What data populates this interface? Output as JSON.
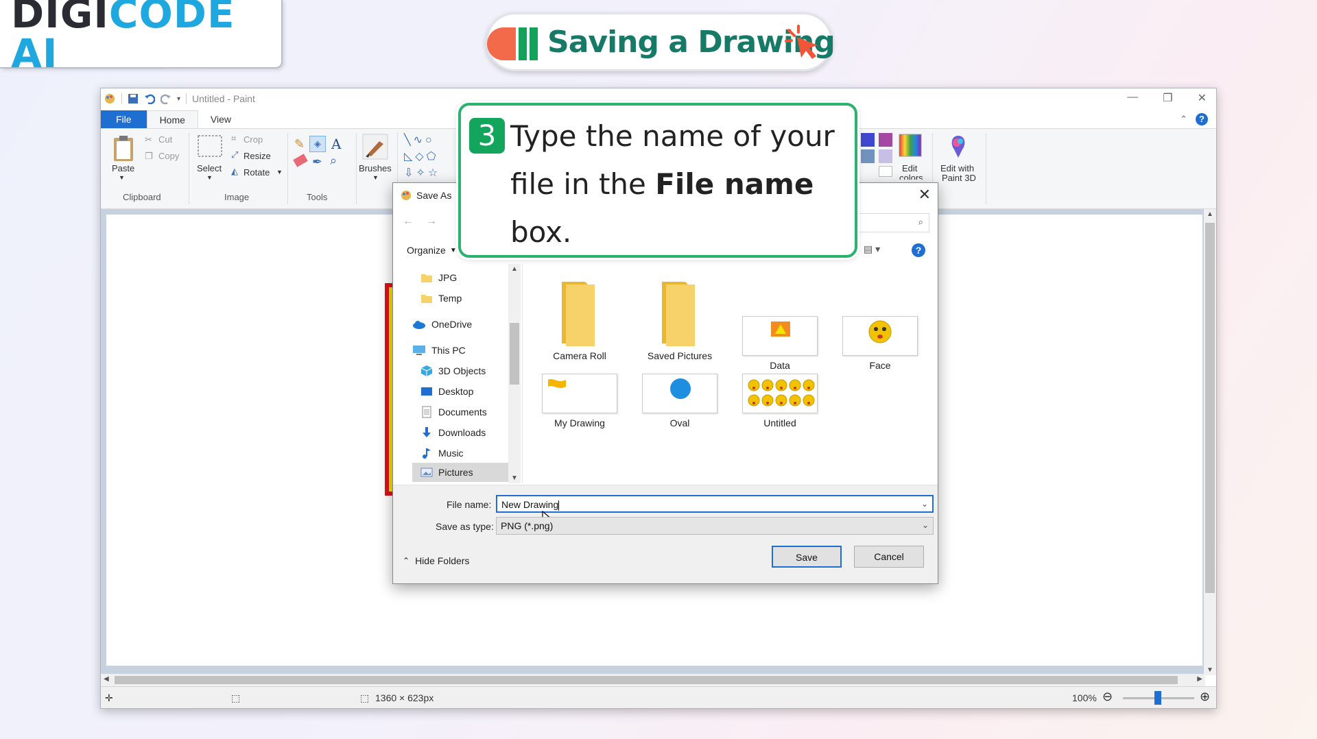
{
  "brand": {
    "logo_part1": "DIGI",
    "logo_part2": "CODE",
    "logo_part3": " AI"
  },
  "lesson": {
    "title": "Saving a Drawing"
  },
  "colors": {
    "accent_blue": "#1e6fd1",
    "callout_green": "#2ab36e",
    "title_teal": "#167a66",
    "brand_blue": "#1fa7e0"
  },
  "paint": {
    "window_title": "Untitled - Paint",
    "tabs": {
      "file": "File",
      "home": "Home",
      "view": "View"
    },
    "clipboard": {
      "paste": "Paste",
      "cut": "Cut",
      "copy": "Copy",
      "group": "Clipboard"
    },
    "image": {
      "select": "Select",
      "crop": "Crop",
      "resize": "Resize",
      "rotate": "Rotate",
      "group": "Image"
    },
    "tools": {
      "group": "Tools",
      "brushes": "Brushes"
    },
    "colors": {
      "edit_colors_1": "Edit",
      "edit_colors_2": "colors",
      "edit_3d_1": "Edit with",
      "edit_3d_2": "Paint 3D"
    },
    "status": {
      "dimensions": "1360 × 623px",
      "zoom": "100%"
    }
  },
  "dialog": {
    "title": "Save As",
    "organize": "Organize",
    "nav_items": [
      {
        "label": "JPG",
        "icon": "folder-icon"
      },
      {
        "label": "Temp",
        "icon": "folder-icon"
      },
      {
        "label": "OneDrive",
        "icon": "cloud-icon"
      },
      {
        "label": "This PC",
        "icon": "computer-icon"
      },
      {
        "label": "3D Objects",
        "icon": "cube-icon"
      },
      {
        "label": "Desktop",
        "icon": "desktop-icon"
      },
      {
        "label": "Documents",
        "icon": "document-icon"
      },
      {
        "label": "Downloads",
        "icon": "download-icon"
      },
      {
        "label": "Music",
        "icon": "music-icon"
      },
      {
        "label": "Pictures",
        "icon": "pictures-icon"
      }
    ],
    "files": [
      {
        "label": "Camera Roll"
      },
      {
        "label": "Saved Pictures"
      },
      {
        "label": "Data"
      },
      {
        "label": "Face"
      },
      {
        "label": "My Drawing"
      },
      {
        "label": "Oval"
      },
      {
        "label": "Untitled"
      }
    ],
    "file_name_label": "File name:",
    "file_name_value": "New Drawing",
    "save_type_label": "Save as type:",
    "save_type_value": "PNG (*.png)",
    "hide_folders": "Hide Folders",
    "save": "Save",
    "cancel": "Cancel"
  },
  "callout": {
    "step": "3",
    "text_before": "Type the name of your file in the ",
    "text_bold": "File name",
    "text_after": " box."
  }
}
